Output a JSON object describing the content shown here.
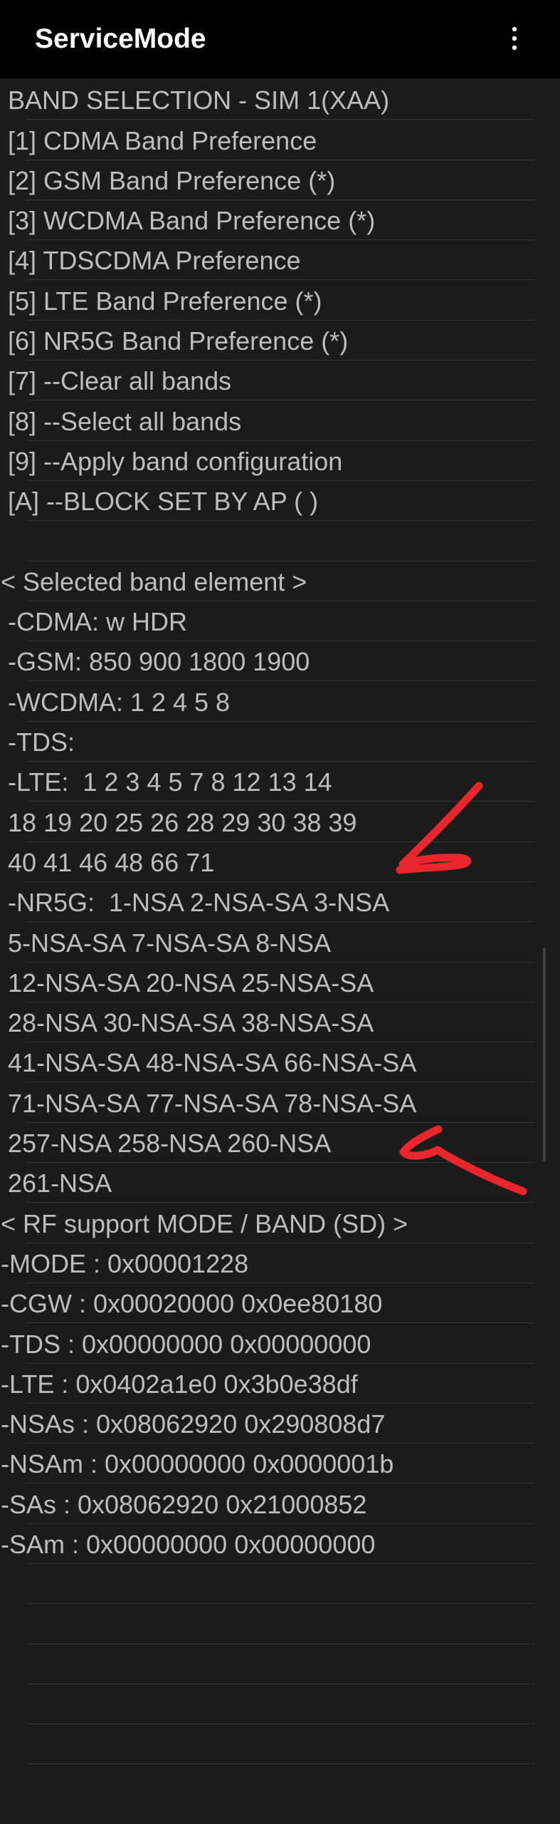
{
  "app": {
    "title": "ServiceMode",
    "more_icon": "more-vertical-icon"
  },
  "colors": {
    "background": "#1b1b1b",
    "appbar": "#000000",
    "text": "#bdbdbd",
    "divider": "#343434",
    "annotation": "#e8262c"
  },
  "rows": [
    "BAND SELECTION - SIM 1(XAA)",
    "[1] CDMA Band Preference",
    "[2] GSM Band Preference (*)",
    "[3] WCDMA Band Preference (*)",
    "[4] TDSCDMA Preference",
    "[5] LTE Band Preference (*)",
    "[6] NR5G Band Preference (*)",
    "[7] --Clear all bands",
    "[8] --Select all bands",
    "[9] --Apply band configuration",
    "[A] --BLOCK SET BY AP ( )",
    "",
    "< Selected band element >",
    "-CDMA: w HDR",
    "-GSM: 850 900 1800 1900",
    "-WCDMA: 1 2 4 5 8",
    "-TDS:",
    "-LTE:  1 2 3 4 5 7 8 12 13 14",
    "18 19 20 25 26 28 29 30 38 39",
    "40 41 46 48 66 71",
    "-NR5G:  1-NSA 2-NSA-SA 3-NSA",
    "5-NSA-SA 7-NSA-SA 8-NSA",
    "12-NSA-SA 20-NSA 25-NSA-SA",
    "28-NSA 30-NSA-SA 38-NSA-SA",
    "41-NSA-SA 48-NSA-SA 66-NSA-SA",
    "71-NSA-SA 77-NSA-SA 78-NSA-SA",
    "257-NSA 258-NSA 260-NSA",
    "261-NSA",
    "< RF support MODE / BAND (SD) >",
    "-MODE : 0x00001228",
    "-CGW : 0x00020000 0x0ee80180",
    "-TDS : 0x00000000 0x00000000",
    "-LTE : 0x0402a1e0 0x3b0e38df",
    "-NSAs : 0x08062920 0x290808d7",
    "-NSAm : 0x00000000 0x0000001b",
    "-SAs : 0x08062920 0x21000852",
    "-SAm : 0x00000000 0x00000000",
    "",
    "",
    "",
    "",
    ""
  ],
  "flush_rows": [
    12,
    28,
    29,
    30,
    31,
    32,
    33,
    34,
    35,
    36
  ]
}
